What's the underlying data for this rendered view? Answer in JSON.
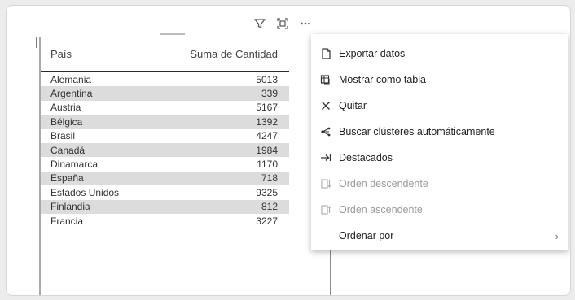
{
  "header_icons": [
    "filter-icon",
    "focus-mode-icon",
    "more-options-icon"
  ],
  "table": {
    "columns": [
      "País",
      "Suma de Cantidad"
    ],
    "rows": [
      {
        "pais": "Alemania",
        "suma": "5013"
      },
      {
        "pais": "Argentina",
        "suma": "339"
      },
      {
        "pais": "Austria",
        "suma": "5167"
      },
      {
        "pais": "Bélgica",
        "suma": "1392"
      },
      {
        "pais": "Brasil",
        "suma": "4247"
      },
      {
        "pais": "Canadá",
        "suma": "1984"
      },
      {
        "pais": "Dinamarca",
        "suma": "1170"
      },
      {
        "pais": "España",
        "suma": "718"
      },
      {
        "pais": "Estados Unidos",
        "suma": "9325"
      },
      {
        "pais": "Finlandia",
        "suma": "812"
      },
      {
        "pais": "Francia",
        "suma": "3227"
      }
    ]
  },
  "menu": {
    "items": [
      {
        "label": "Exportar datos",
        "icon": "export-icon",
        "disabled": false
      },
      {
        "label": "Mostrar como tabla",
        "icon": "table-view-icon",
        "disabled": false
      },
      {
        "label": "Quitar",
        "icon": "close-icon",
        "disabled": false
      },
      {
        "label": "Buscar clústeres automáticamente",
        "icon": "cluster-icon",
        "disabled": false
      },
      {
        "label": "Destacados",
        "icon": "highlight-icon",
        "disabled": false
      },
      {
        "label": "Orden descendente",
        "icon": "sort-descending-icon",
        "disabled": true
      },
      {
        "label": "Orden ascendente",
        "icon": "sort-ascending-icon",
        "disabled": true
      },
      {
        "label": "Ordenar por",
        "icon": "",
        "disabled": false,
        "submenu": true
      }
    ]
  }
}
